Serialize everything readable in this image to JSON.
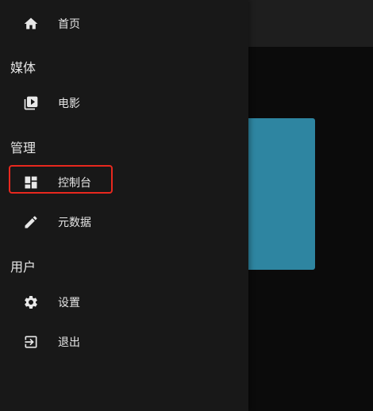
{
  "nav": {
    "home": {
      "label": "首页",
      "icon": "home-icon"
    },
    "media_header": "媒体",
    "movies": {
      "label": "电影",
      "icon": "video-library-icon"
    },
    "admin_header": "管理",
    "dashboard": {
      "label": "控制台",
      "icon": "dashboard-icon",
      "highlighted": true
    },
    "metadata": {
      "label": "元数据",
      "icon": "pencil-icon"
    },
    "user_header": "用户",
    "settings": {
      "label": "设置",
      "icon": "gear-icon"
    },
    "logout": {
      "label": "退出",
      "icon": "logout-icon"
    }
  },
  "colors": {
    "drawer_bg": "#181818",
    "highlight_border": "#e8281e",
    "card_accent": "#2e85a1"
  }
}
